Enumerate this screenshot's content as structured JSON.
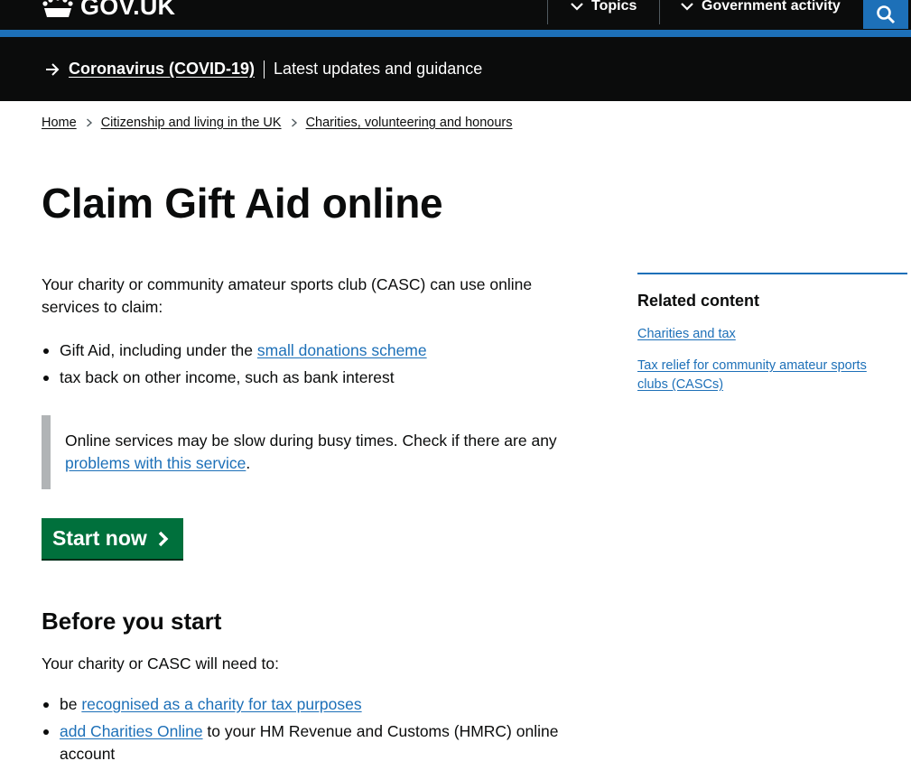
{
  "header": {
    "logo_text": "GOV.UK",
    "nav": [
      {
        "label": "Topics"
      },
      {
        "label": "Government activity"
      }
    ],
    "search_icon": "search-icon"
  },
  "banner": {
    "link": "Coronavirus (COVID-19)",
    "text": "Latest updates and guidance"
  },
  "breadcrumb": [
    "Home",
    "Citizenship and living in the UK",
    "Charities, volunteering and honours"
  ],
  "page": {
    "title": "Claim Gift Aid online",
    "intro": "Your charity or community amateur sports club (CASC) can use online services to claim:",
    "list1": {
      "item1_text": "Gift Aid, including under the ",
      "item1_link": "small donations scheme",
      "item2_text": "tax back on other income, such as bank interest"
    },
    "inset": {
      "text": "Online services may be slow during busy times. Check if there are any ",
      "link": "problems with this service",
      "end": "."
    },
    "start_button": "Start now",
    "before_heading": "Before you start",
    "before_intro": "Your charity or CASC will need to:",
    "list2": {
      "item1_text": "be ",
      "item1_link": "recognised as a charity for tax purposes",
      "item2_link": "add Charities Online",
      "item2_text": " to your HM Revenue and Customs (HMRC) online account"
    }
  },
  "related": {
    "title": "Related content",
    "links": [
      "Charities and tax",
      "Tax relief for community amateur sports clubs (CASCs)"
    ]
  },
  "colors": {
    "brand_blue": "#1d70b8",
    "header_black": "#0b0c0c",
    "button_green": "#00703c",
    "inset_grey": "#b1b4b6"
  }
}
